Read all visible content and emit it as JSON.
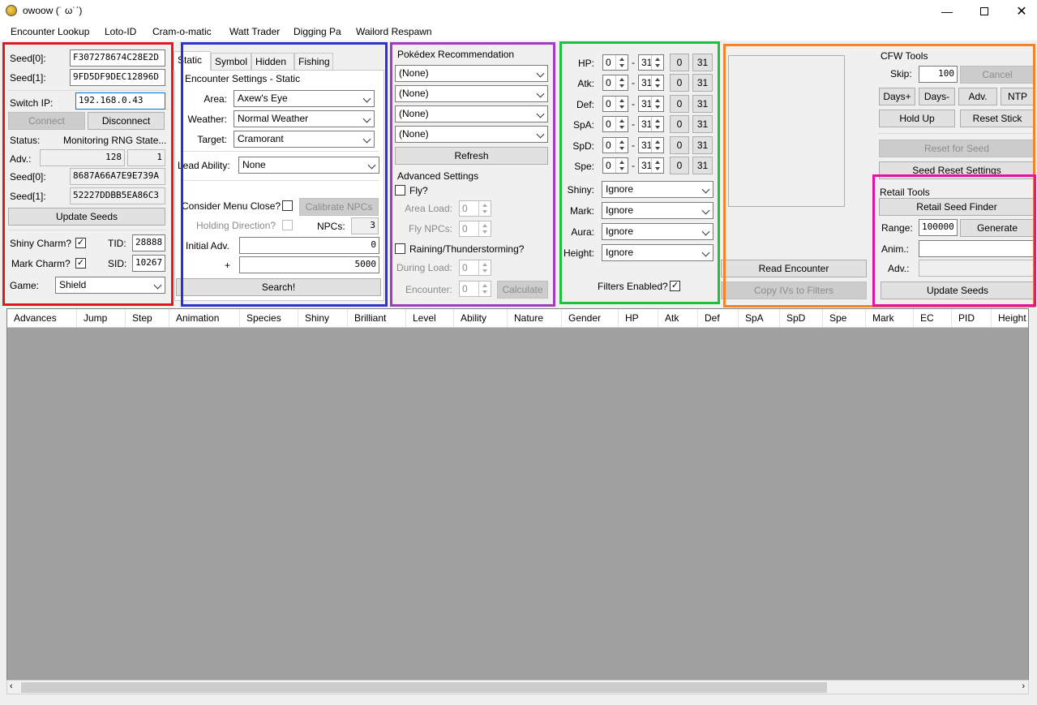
{
  "window": {
    "title": "owoow (˙ ω˙ˊ)"
  },
  "menu": [
    "Encounter Lookup",
    "Loto-ID",
    "Cram-o-matic",
    "Watt Trader",
    "Digging Pa",
    "Wailord Respawn"
  ],
  "connection": {
    "seed0_label": "Seed[0]:",
    "seed0": "F307278674C28E2D",
    "seed1_label": "Seed[1]:",
    "seed1": "9FD5DF9DEC12896D",
    "ip_label": "Switch IP:",
    "ip": "192.168.0.43",
    "connect": "Connect",
    "disconnect": "Disconnect",
    "status_label": "Status:",
    "status": "Monitoring RNG State...",
    "adv_label": "Adv.:",
    "adv": "128",
    "adv2": "1",
    "cur_seed0_label": "Seed[0]:",
    "cur_seed0": "8687A66A7E9E739A",
    "cur_seed1_label": "Seed[1]:",
    "cur_seed1": "52227DDBB5EA86C3",
    "update_seeds": "Update Seeds",
    "shiny_charm_label": "Shiny Charm?",
    "shiny_charm": "✓",
    "tid_label": "TID:",
    "tid": "28888",
    "mark_charm_label": "Mark Charm?",
    "mark_charm": "✓",
    "sid_label": "SID:",
    "sid": "10267",
    "game_label": "Game:",
    "game": "Shield"
  },
  "encounter": {
    "tabs": [
      "Static",
      "Symbol",
      "Hidden",
      "Fishing"
    ],
    "group_title": "Encounter Settings - Static",
    "area_label": "Area:",
    "area": "Axew's Eye",
    "weather_label": "Weather:",
    "weather": "Normal Weather",
    "target_label": "Target:",
    "target": "Cramorant",
    "lead_label": "Lead Ability:",
    "lead": "None",
    "menu_close_label": "Consider Menu Close?",
    "calibrate": "Calibrate NPCs",
    "holding_label": "Holding Direction?",
    "npcs_label": "NPCs:",
    "npcs": "3",
    "initial_label": "Initial Adv.",
    "initial": "0",
    "plus_label": "+",
    "plus": "5000",
    "search": "Search!"
  },
  "pokedex": {
    "title": "Pokédex Recommendation",
    "options": [
      "(None)",
      "(None)",
      "(None)",
      "(None)"
    ],
    "refresh": "Refresh",
    "adv_title": "Advanced Settings",
    "fly_label": "Fly?",
    "area_load_label": "Area Load:",
    "area_load": "0",
    "fly_npcs_label": "Fly NPCs:",
    "fly_npcs": "0",
    "raining_label": "Raining/Thunderstorming?",
    "during_load_label": "During Load:",
    "during_load": "0",
    "encounter_label": "Encounter:",
    "encounter": "0",
    "calculate": "Calculate"
  },
  "filters": {
    "ivs": [
      {
        "label": "HP:",
        "min": "0",
        "max": "31",
        "b0": "0",
        "b31": "31"
      },
      {
        "label": "Atk:",
        "min": "0",
        "max": "31",
        "b0": "0",
        "b31": "31"
      },
      {
        "label": "Def:",
        "min": "0",
        "max": "31",
        "b0": "0",
        "b31": "31"
      },
      {
        "label": "SpA:",
        "min": "0",
        "max": "31",
        "b0": "0",
        "b31": "31"
      },
      {
        "label": "SpD:",
        "min": "0",
        "max": "31",
        "b0": "0",
        "b31": "31"
      },
      {
        "label": "Spe:",
        "min": "0",
        "max": "31",
        "b0": "0",
        "b31": "31"
      }
    ],
    "dash": "-",
    "shiny_label": "Shiny:",
    "shiny": "Ignore",
    "mark_label": "Mark:",
    "mark": "Ignore",
    "aura_label": "Aura:",
    "aura": "Ignore",
    "height_label": "Height:",
    "height": "Ignore",
    "enabled_label": "Filters Enabled?",
    "enabled": "✓"
  },
  "reader": {
    "read": "Read Encounter",
    "copy": "Copy IVs to Filters"
  },
  "cfw": {
    "title": "CFW Tools",
    "skip_label": "Skip:",
    "skip": "100",
    "cancel": "Cancel",
    "days_plus": "Days+",
    "days_minus": "Days-",
    "adv": "Adv.",
    "ntp": "NTP",
    "hold_up": "Hold Up",
    "reset_stick": "Reset Stick",
    "reset_for_seed": "Reset for Seed",
    "seed_reset_settings": "Seed Reset Settings"
  },
  "retail": {
    "title": "Retail Tools",
    "finder": "Retail Seed Finder",
    "range_label": "Range:",
    "range": "100000",
    "generate": "Generate",
    "anim_label": "Anim.:",
    "adv_label": "Adv.:",
    "update": "Update Seeds"
  },
  "columns": [
    "Advances",
    "Jump",
    "Step",
    "Animation",
    "Species",
    "Shiny",
    "Brilliant",
    "Level",
    "Ability",
    "Nature",
    "Gender",
    "HP",
    "Atk",
    "Def",
    "SpA",
    "SpD",
    "Spe",
    "Mark",
    "EC",
    "PID",
    "Height"
  ],
  "highlight_colors": {
    "connection": "#e0191f",
    "encounter": "#2b33c9",
    "pokedex": "#a43ac4",
    "filters": "#19c43c",
    "cfw": "#f4832a",
    "retail": "#e112a8"
  }
}
